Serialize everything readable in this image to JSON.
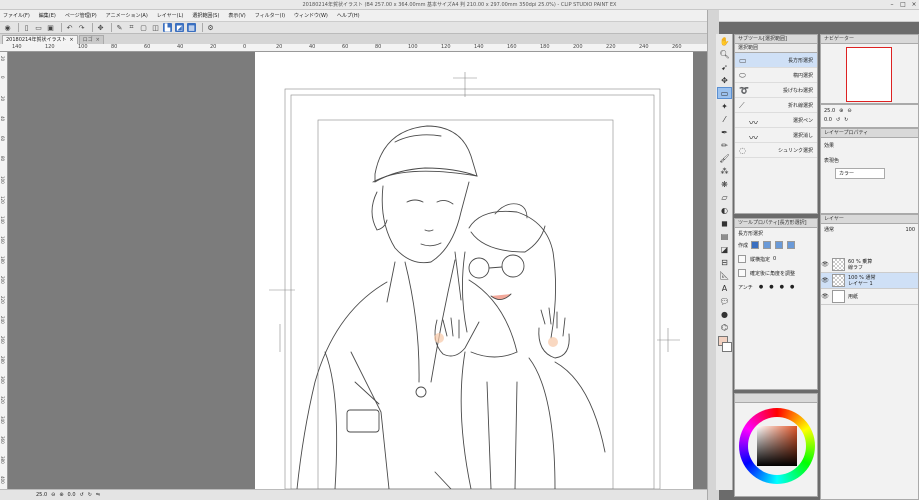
{
  "window": {
    "title": "20180214年賀状イラスト (B4 257.00 x 364.00mm 基本サイズA4 判 210.00 x 297.00mm 350dpi 25.0%) - CLIP STUDIO PAINT EX",
    "minimize": "–",
    "maximize": "□",
    "close": "×"
  },
  "menu": [
    "ファイル(F)",
    "編集(E)",
    "ページ管理(P)",
    "アニメーション(A)",
    "レイヤー(L)",
    "選択範囲(S)",
    "表示(V)",
    "フィルター(I)",
    "ウィンドウ(W)",
    "ヘルプ(H)"
  ],
  "tabs": [
    {
      "label": "20180214年賀状イラスト",
      "close": "×"
    },
    {
      "label": "ロゴ",
      "close": "×"
    }
  ],
  "ruler_top": [
    "140",
    "120",
    "100",
    "80",
    "60",
    "40",
    "20",
    "0",
    "20",
    "40",
    "60",
    "80",
    "100",
    "120",
    "140",
    "160",
    "180",
    "200",
    "220",
    "240",
    "260"
  ],
  "ruler_left": [
    "20",
    "0",
    "20",
    "40",
    "60",
    "80",
    "100",
    "120",
    "140",
    "160",
    "180",
    "200",
    "220",
    "240",
    "260",
    "280",
    "300",
    "320",
    "340",
    "360",
    "380",
    "400"
  ],
  "status": {
    "zoom": "25.0",
    "angle": "0.0"
  },
  "subtool": {
    "panel_title": "サブツール[選択範囲]",
    "group_tab": "選択範囲",
    "items": [
      {
        "label": "長方形選択",
        "icon": "rect"
      },
      {
        "label": "楕円選択",
        "icon": "ellipse"
      },
      {
        "label": "投げなわ選択",
        "icon": "lasso"
      },
      {
        "label": "折れ線選択",
        "icon": "polyline"
      },
      {
        "label": "選択ペン",
        "icon": "pen"
      },
      {
        "label": "選択消し",
        "icon": "eraser"
      },
      {
        "label": "シュリンク選択",
        "icon": "shrink"
      }
    ]
  },
  "toolprop": {
    "panel_title": "ツールプロパティ[長方形選択]",
    "tool_name": "長方形選択",
    "mode_label": "作成",
    "aspect_label": "縦横指定",
    "aspect_value": "0",
    "confirm_label": "確定後に角度を調整",
    "aa_label": "アンチ"
  },
  "navigator": {
    "panel_title": "ナビゲーター",
    "zoom": "25.0",
    "angle": "0.0"
  },
  "layerprop": {
    "panel_title": "レイヤープロパティ",
    "effect_label": "効果",
    "color_label": "表現色",
    "color_value": "カラー"
  },
  "layers": {
    "panel_title": "レイヤー",
    "blend": "通常",
    "opacity": "100",
    "rows": [
      {
        "line1": "60 % 乗算",
        "line2": "線ラフ",
        "visible": true,
        "selected": false
      },
      {
        "line1": "100 % 通常",
        "line2": "レイヤー 1",
        "visible": true,
        "selected": true
      },
      {
        "line1": "",
        "line2": "用紙",
        "visible": true,
        "selected": false
      }
    ]
  },
  "colors": {
    "main": "#f2d2c2",
    "sub": "#ffffff"
  }
}
